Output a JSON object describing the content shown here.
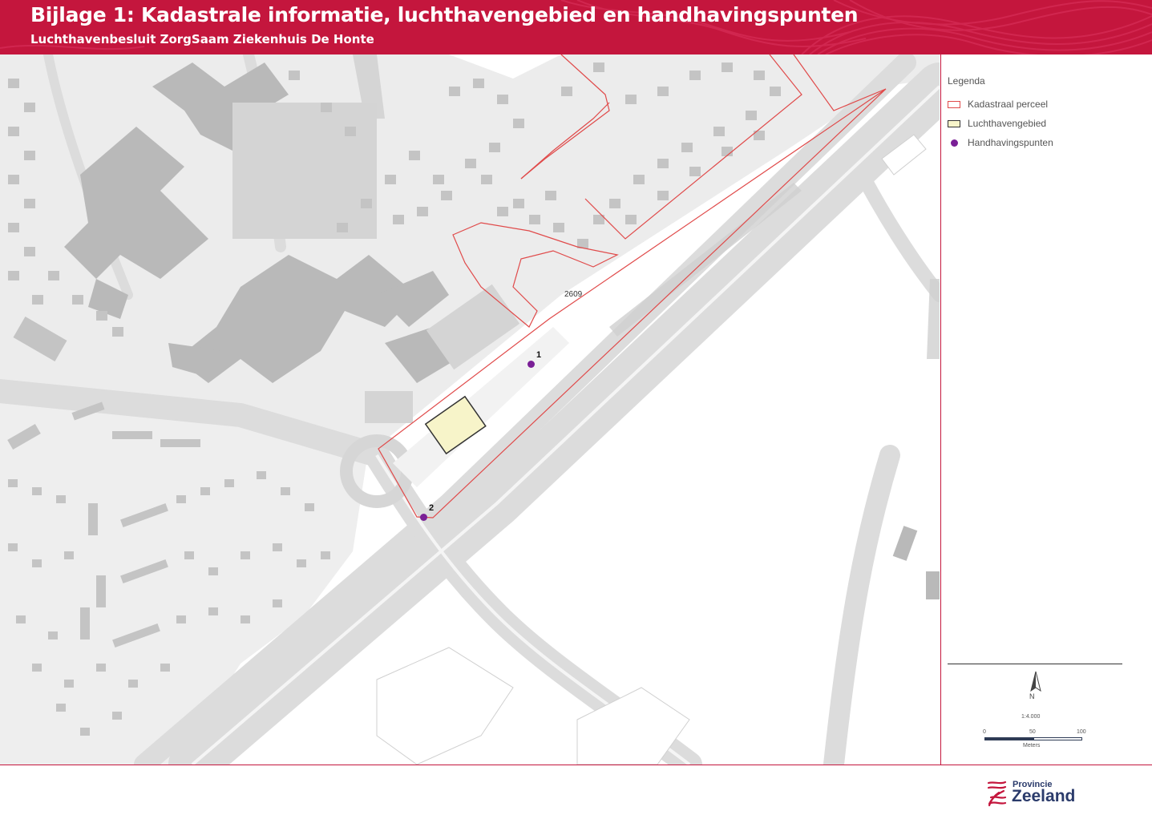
{
  "header": {
    "title": "Bijlage 1:  Kadastrale informatie, luchthavengebied en handhavingspunten",
    "subtitle": "Luchthavenbesluit ZorgSaam Ziekenhuis De Honte",
    "color": "#c4163d"
  },
  "map": {
    "parcel_number": "2609",
    "points": [
      {
        "label": "1"
      },
      {
        "label": "2"
      }
    ],
    "colors": {
      "parcel": "#e04a4a",
      "area_fill": "#f7f4c9",
      "point": "#7a1f96",
      "building": "#bdbdbd",
      "road": "#e6e6e6"
    }
  },
  "legend": {
    "title": "Legenda",
    "items": [
      {
        "label": "Kadastraal perceel",
        "symbol": "red-outline-box"
      },
      {
        "label": "Luchthavengebied",
        "symbol": "yellow-filled-box"
      },
      {
        "label": "Handhavingspunten",
        "symbol": "purple-dot"
      }
    ]
  },
  "scale": {
    "ratio": "1:4.000",
    "ticks": [
      "0",
      "50",
      "100"
    ],
    "units": "Meters",
    "north": "N"
  },
  "logo": {
    "line1": "Provincie",
    "line2": "Zeeland"
  }
}
